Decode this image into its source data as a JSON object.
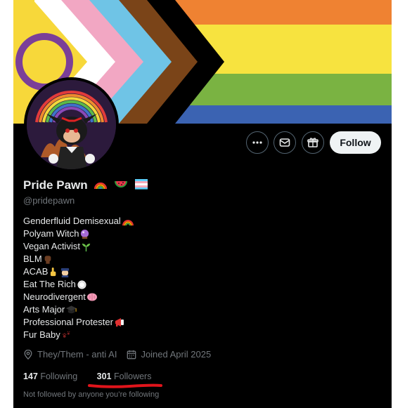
{
  "profile": {
    "display_name": "Pride Pawn",
    "name_emojis": [
      "rainbow-emoji",
      "watermelon-emoji",
      "trans-flag-emoji"
    ],
    "handle": "@pridepawn",
    "bio": [
      {
        "text": "Genderfluid Demisexual",
        "icon": "rainbow-emoji"
      },
      {
        "text": "Polyam Witch",
        "icon": "crystal-ball-emoji"
      },
      {
        "text": "Vegan Activist",
        "icon": "seedling-emoji"
      },
      {
        "text": "BLM",
        "icon": "raised-fist-emoji"
      },
      {
        "text": "ACAB",
        "icon": "middle-finger-police-emoji"
      },
      {
        "text": "Eat The Rich",
        "icon": "plate-emoji"
      },
      {
        "text": "Neurodivergent",
        "icon": "brain-emoji"
      },
      {
        "text": "Arts Major",
        "icon": "graduation-cap-emoji"
      },
      {
        "text": "Professional Protester",
        "icon": "megaphone-emoji"
      },
      {
        "text": "Fur Baby",
        "icon": "paw-prints-emoji"
      }
    ],
    "location": "They/Them - anti AI",
    "joined": "Joined April 2025",
    "following_count": "147",
    "following_label": "Following",
    "followers_count": "301",
    "followers_label": "Followers",
    "not_followed_text": "Not followed by anyone you’re following"
  },
  "actions": {
    "follow_label": "Follow",
    "more_icon": "more-icon",
    "message_icon": "message-icon",
    "gift_icon": "gift-icon"
  },
  "colors": {
    "background": "#000000",
    "primary_text": "#e7e9ea",
    "secondary_text": "#71767b",
    "follow_bg": "#eff3f4",
    "annotation_red": "#e0141b"
  }
}
